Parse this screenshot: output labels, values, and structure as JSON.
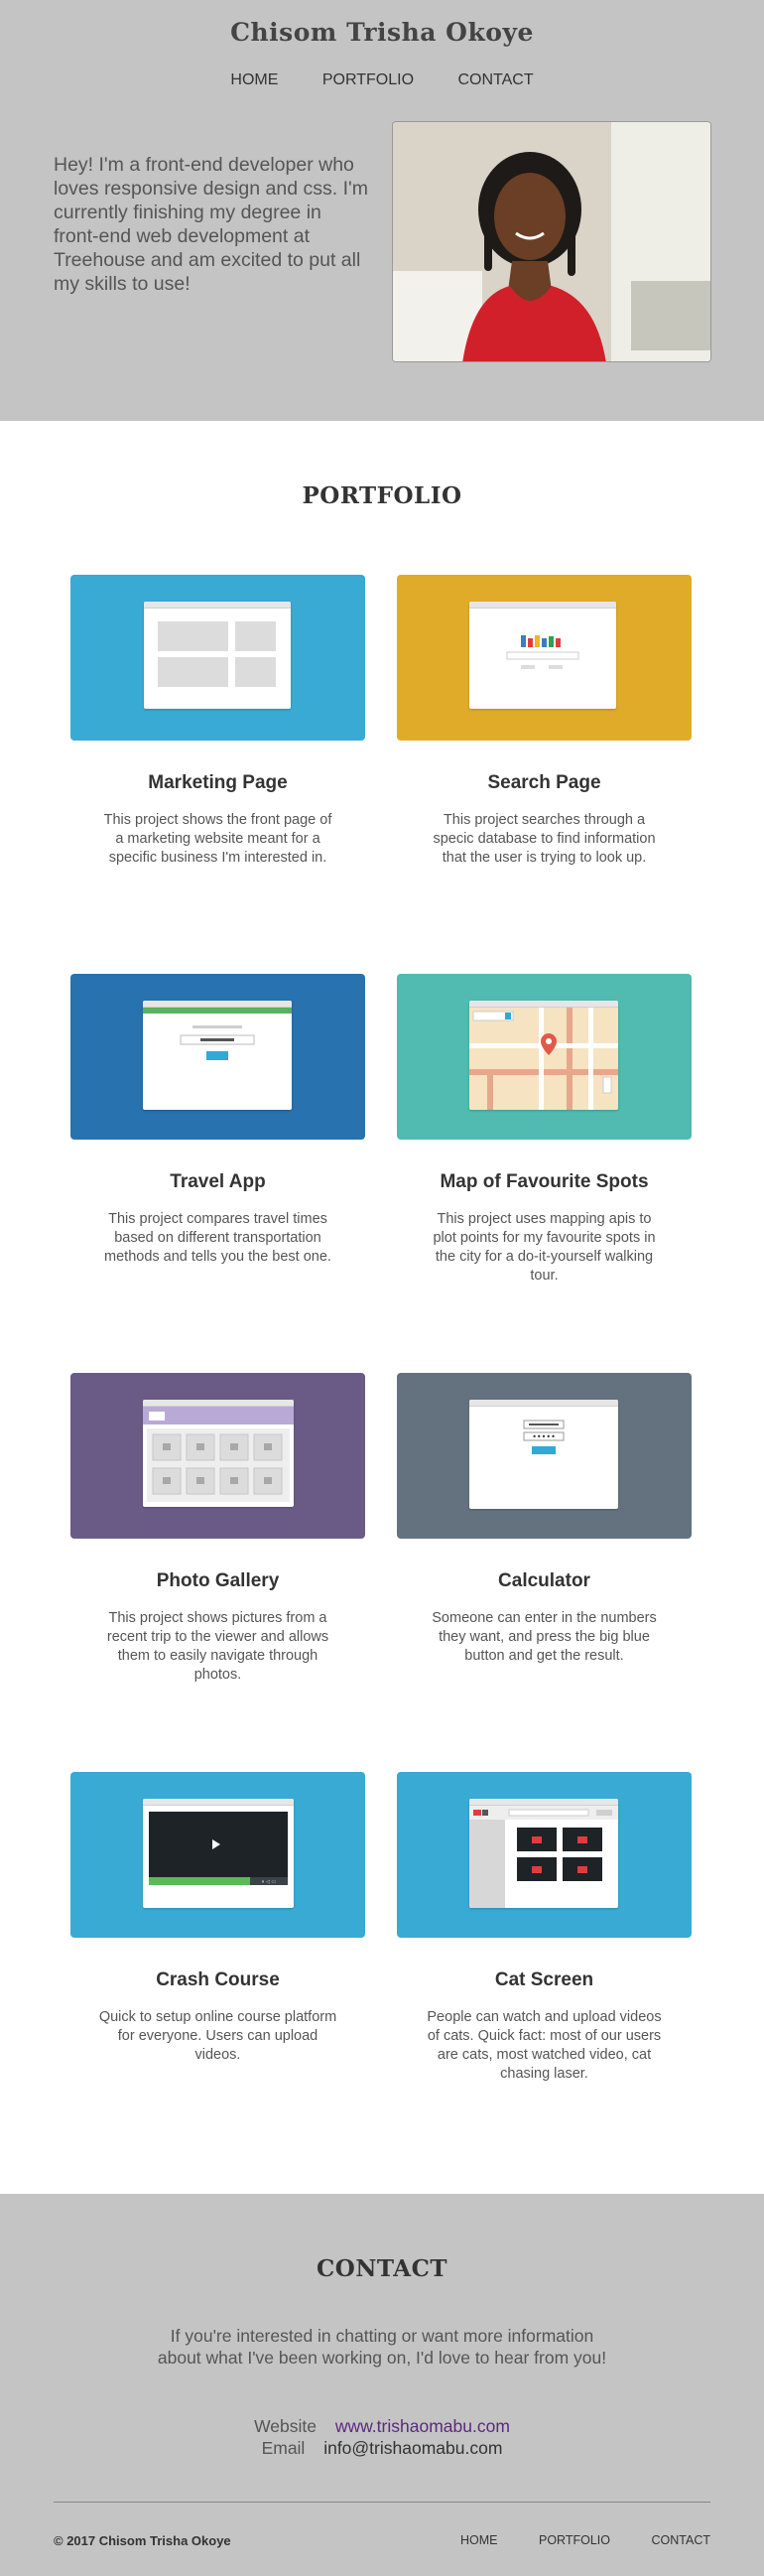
{
  "header": {
    "site_title": "Chisom Trisha Okoye",
    "nav": [
      "HOME",
      "PORTFOLIO",
      "CONTACT"
    ]
  },
  "hero": {
    "intro": "Hey! I'm a front-end developer who loves responsive design and css. I'm currently finishing my degree in front-end web development at Treehouse and am excited to put all my skills to use!"
  },
  "portfolio": {
    "title": "PORTFOLIO",
    "projects": [
      {
        "title": "Marketing Page",
        "description": "This project shows the front page of a marketing website meant for a specific business I'm interested in.",
        "color": "#38aad3",
        "icon": "marketing-page-thumbnail"
      },
      {
        "title": "Search Page",
        "description": "This project searches through a specic database to find information that the user is trying to look up.",
        "color": "#e0ab28",
        "icon": "search-page-thumbnail"
      },
      {
        "title": "Travel App",
        "description": "This project compares travel times based on different transportation methods and tells you the best one.",
        "color": "#2772af",
        "icon": "travel-app-thumbnail"
      },
      {
        "title": "Map of Favourite Spots",
        "description": "This project uses mapping apis to plot points for my favourite spots in the city for a do-it-yourself walking tour.",
        "color": "#51bab1",
        "icon": "map-thumbnail"
      },
      {
        "title": "Photo Gallery",
        "description": "This project shows pictures from a recent trip to the viewer and allows them to easily navigate through photos.",
        "color": "#695b86",
        "icon": "photo-gallery-thumbnail"
      },
      {
        "title": "Calculator",
        "description": "Someone can enter in the numbers they want, and press the big blue button and get the result.",
        "color": "#63727e",
        "icon": "calculator-thumbnail"
      },
      {
        "title": "Crash Course",
        "description": "Quick to setup online course platform for everyone. Users can upload videos.",
        "color": "#38aad3",
        "icon": "video-player-thumbnail"
      },
      {
        "title": "Cat Screen",
        "description": "People can watch and upload videos of cats. Quick fact: most of our users are cats, most watched video, cat chasing laser.",
        "color": "#38aad3",
        "icon": "video-grid-thumbnail"
      }
    ]
  },
  "contact": {
    "title": "CONTACT",
    "text": "If you're interested in chatting or want more information about what I've been working on, I'd love to hear from you!",
    "website_label": "Website",
    "website_value": "www.trishaomabu.com",
    "email_label": "Email",
    "email_value": "info@trishaomabu.com"
  },
  "footer": {
    "copyright": "© 2017 Chisom Trisha Okoye",
    "nav": [
      "HOME",
      "PORTFOLIO",
      "CONTACT"
    ]
  }
}
